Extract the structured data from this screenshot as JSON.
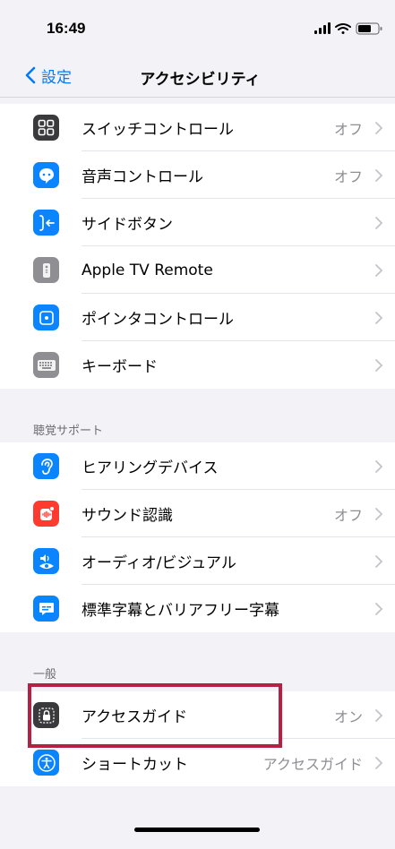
{
  "status_bar": {
    "time": "16:49"
  },
  "nav": {
    "back_label": "設定",
    "title": "アクセシビリティ"
  },
  "group1": {
    "items": [
      {
        "label": "スイッチコントロール",
        "value": "オフ",
        "icon": "switch-control-icon",
        "color": "#3a3a3c"
      },
      {
        "label": "音声コントロール",
        "value": "オフ",
        "icon": "voice-control-icon",
        "color": "#0a84ff"
      },
      {
        "label": "サイドボタン",
        "value": "",
        "icon": "side-button-icon",
        "color": "#0a84ff"
      },
      {
        "label": "Apple TV Remote",
        "value": "",
        "icon": "remote-icon",
        "color": "#8e8e93"
      },
      {
        "label": "ポインタコントロール",
        "value": "",
        "icon": "pointer-control-icon",
        "color": "#0a84ff"
      },
      {
        "label": "キーボード",
        "value": "",
        "icon": "keyboard-icon",
        "color": "#8e8e93"
      }
    ]
  },
  "hearing": {
    "header": "聴覚サポート",
    "items": [
      {
        "label": "ヒアリングデバイス",
        "value": "",
        "icon": "ear-icon",
        "color": "#0a84ff"
      },
      {
        "label": "サウンド認識",
        "value": "オフ",
        "icon": "sound-recognition-icon",
        "color": "#ff3b30"
      },
      {
        "label": "オーディオ/ビジュアル",
        "value": "",
        "icon": "audio-visual-icon",
        "color": "#0a84ff"
      },
      {
        "label": "標準字幕とバリアフリー字幕",
        "value": "",
        "icon": "subtitles-icon",
        "color": "#0a84ff"
      }
    ]
  },
  "general": {
    "header": "一般",
    "items": [
      {
        "label": "アクセスガイド",
        "value": "オン",
        "icon": "guided-access-icon",
        "color": "#3a3a3c"
      },
      {
        "label": "ショートカット",
        "value": "アクセスガイド",
        "icon": "accessibility-shortcut-icon",
        "color": "#0a84ff"
      }
    ]
  }
}
